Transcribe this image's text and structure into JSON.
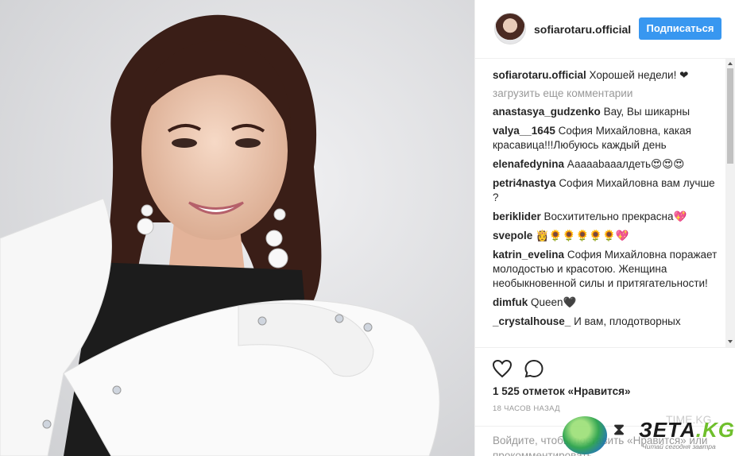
{
  "post": {
    "username": "sofiarotaru.official",
    "follow_label": "Подписаться",
    "caption": "Хорошей недели! ❤"
  },
  "comments": {
    "load_more": "загрузить еще комментарии",
    "items": [
      {
        "user": "anastasya_gudzenko",
        "text": "Вау, Вы шикарны"
      },
      {
        "user": "valya__1645",
        "text": "София Михайловна, какая красавица!!!Любуюсь каждый день"
      },
      {
        "user": "elenafedynina",
        "text": "Аааааbaaaлдеть😍😍😍"
      },
      {
        "user": "petri4nastya",
        "text": "София Михайловна вам лучше ?"
      },
      {
        "user": "beriklider",
        "text": "Восхитительно прекрасна💖"
      },
      {
        "user": "svepole",
        "text": "👸🌻🌻🌻🌻🌻💖"
      },
      {
        "user": "katrin_evelina",
        "text": "София Михайловна поражает молодостью и красотою. Женщина необыкновенной силы и притягательности!"
      },
      {
        "user": "dimfuk",
        "text": "Queen🖤"
      },
      {
        "user": "_crystalhouse_",
        "text": "И вам, плодотворных"
      }
    ]
  },
  "actions": {
    "likes": "1 525 отметок «Нравится»",
    "timestamp": "18 ЧАСОВ НАЗАД",
    "login_prompt": "Войдите, чтобы поставить «Нравится» или прокомментировать."
  },
  "watermark": {
    "brand": "ЗЕТА",
    "tld": ".KG",
    "tagline": "Читай сегодня завтра",
    "ghost": "TIME.KG"
  },
  "colors": {
    "accent": "#3897f0",
    "heart": "#c0001d",
    "muted": "#999999"
  },
  "icons": [
    "heart-icon",
    "comment-icon"
  ]
}
